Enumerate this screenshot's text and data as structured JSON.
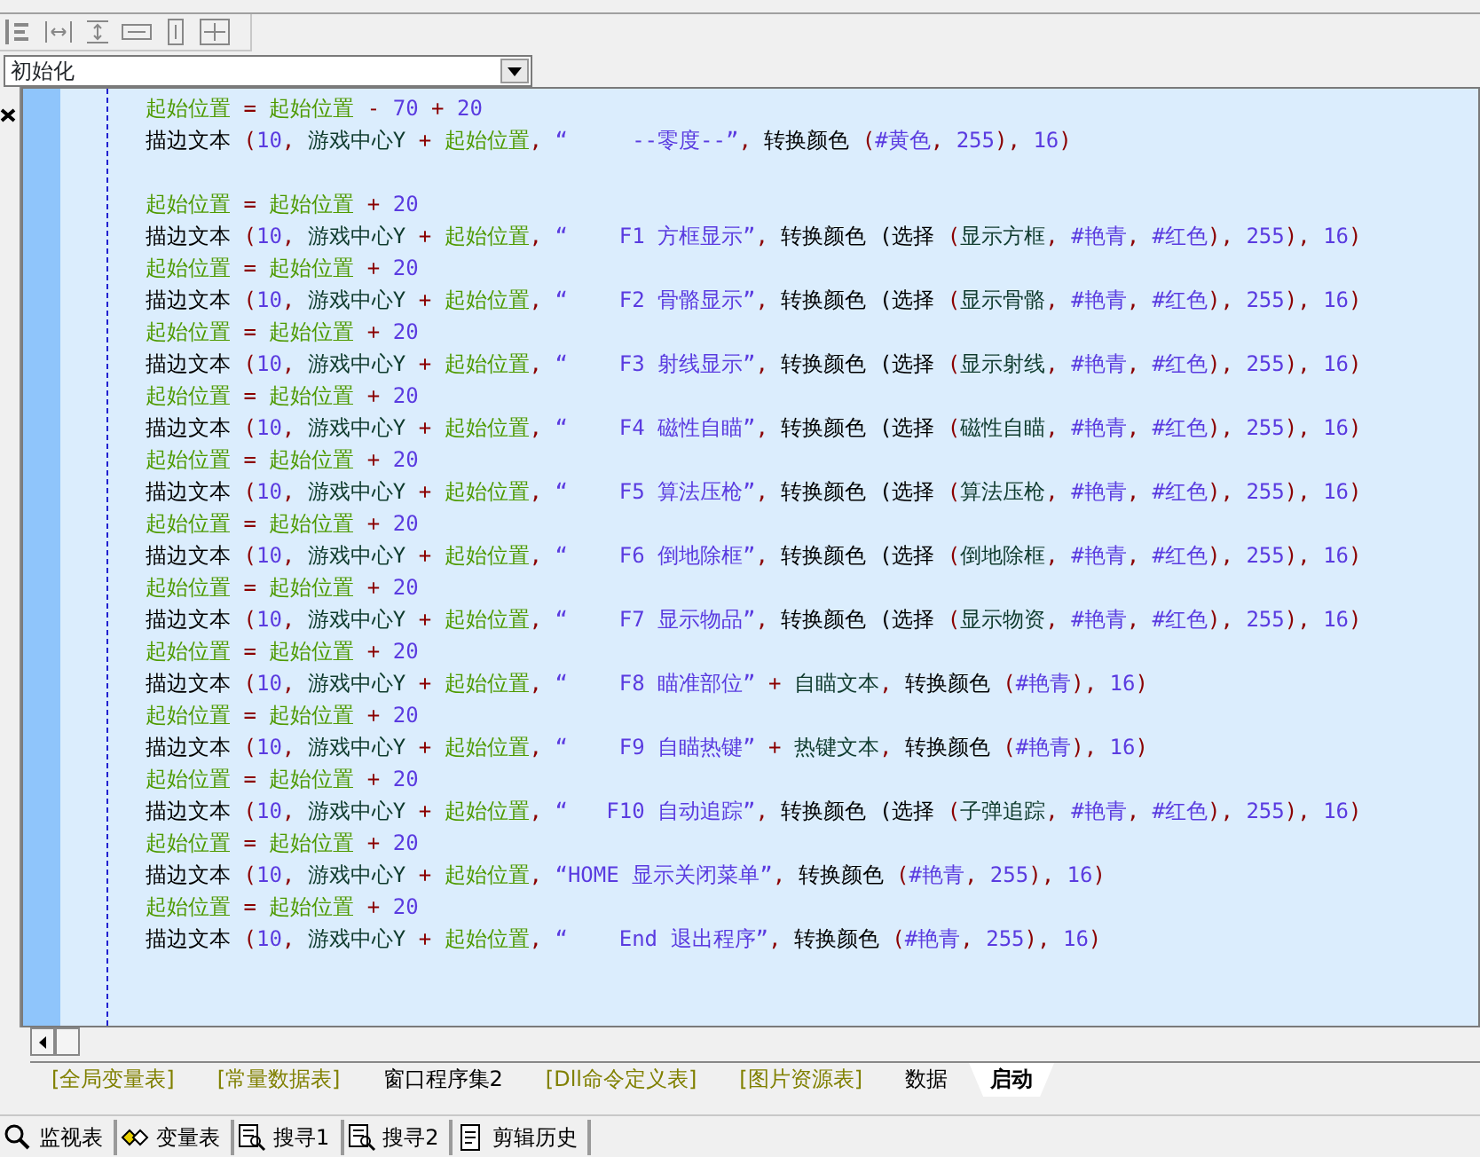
{
  "toolbar": {
    "buttons": [
      {
        "kind": "align-left"
      },
      {
        "kind": "space-h"
      },
      {
        "kind": "space-v"
      },
      {
        "kind": "size-h"
      },
      {
        "kind": "size-v"
      },
      {
        "kind": "size-both"
      }
    ]
  },
  "subroutine_select": {
    "value": "初始化"
  },
  "editor": {
    "lines": [
      {
        "kind": "code",
        "tokens": [
          {
            "kind": "var",
            "text": "起始位置"
          },
          {
            "kind": "op",
            "text": " = "
          },
          {
            "kind": "var",
            "text": "起始位置"
          },
          {
            "kind": "op",
            "text": " - "
          },
          {
            "kind": "num",
            "text": "70"
          },
          {
            "kind": "op",
            "text": " + "
          },
          {
            "kind": "num",
            "text": "20"
          }
        ]
      },
      {
        "kind": "code",
        "tokens": [
          {
            "kind": "func",
            "text": "描边文本 "
          },
          {
            "kind": "op",
            "text": "("
          },
          {
            "kind": "num",
            "text": "10"
          },
          {
            "kind": "op",
            "text": ", "
          },
          {
            "kind": "arg",
            "text": "游戏中心Y "
          },
          {
            "kind": "op",
            "text": "+ "
          },
          {
            "kind": "var",
            "text": "起始位置"
          },
          {
            "kind": "op",
            "text": ", "
          },
          {
            "kind": "str",
            "text": "“     --零度--”"
          },
          {
            "kind": "op",
            "text": ", "
          },
          {
            "kind": "func",
            "text": "转换颜色 "
          },
          {
            "kind": "op",
            "text": "("
          },
          {
            "kind": "str",
            "text": "#黄色"
          },
          {
            "kind": "op",
            "text": ", "
          },
          {
            "kind": "num",
            "text": "255"
          },
          {
            "kind": "op",
            "text": "), "
          },
          {
            "kind": "num",
            "text": "16"
          },
          {
            "kind": "op",
            "text": ")"
          }
        ]
      },
      {
        "kind": "blank"
      },
      {
        "kind": "code",
        "tokens": [
          {
            "kind": "var",
            "text": "起始位置"
          },
          {
            "kind": "op",
            "text": " = "
          },
          {
            "kind": "var",
            "text": "起始位置"
          },
          {
            "kind": "op",
            "text": " + "
          },
          {
            "kind": "num",
            "text": "20"
          }
        ]
      },
      {
        "kind": "code",
        "tokens": [
          {
            "kind": "func",
            "text": "描边文本 "
          },
          {
            "kind": "op",
            "text": "("
          },
          {
            "kind": "num",
            "text": "10"
          },
          {
            "kind": "op",
            "text": ", "
          },
          {
            "kind": "arg",
            "text": "游戏中心Y "
          },
          {
            "kind": "op",
            "text": "+ "
          },
          {
            "kind": "var",
            "text": "起始位置"
          },
          {
            "kind": "op",
            "text": ", "
          },
          {
            "kind": "str",
            "text": "“    F1 方框显示”"
          },
          {
            "kind": "op",
            "text": ", "
          },
          {
            "kind": "func",
            "text": "转换颜色 (选择 "
          },
          {
            "kind": "op",
            "text": "("
          },
          {
            "kind": "arg",
            "text": "显示方框"
          },
          {
            "kind": "op",
            "text": ", "
          },
          {
            "kind": "str",
            "text": "#艳青"
          },
          {
            "kind": "op",
            "text": ", "
          },
          {
            "kind": "str",
            "text": "#红色"
          },
          {
            "kind": "op",
            "text": "), "
          },
          {
            "kind": "num",
            "text": "255"
          },
          {
            "kind": "op",
            "text": "), "
          },
          {
            "kind": "num",
            "text": "16"
          },
          {
            "kind": "op",
            "text": ")"
          }
        ]
      },
      {
        "kind": "code",
        "tokens": [
          {
            "kind": "var",
            "text": "起始位置"
          },
          {
            "kind": "op",
            "text": " = "
          },
          {
            "kind": "var",
            "text": "起始位置"
          },
          {
            "kind": "op",
            "text": " + "
          },
          {
            "kind": "num",
            "text": "20"
          }
        ]
      },
      {
        "kind": "code",
        "tokens": [
          {
            "kind": "func",
            "text": "描边文本 "
          },
          {
            "kind": "op",
            "text": "("
          },
          {
            "kind": "num",
            "text": "10"
          },
          {
            "kind": "op",
            "text": ", "
          },
          {
            "kind": "arg",
            "text": "游戏中心Y "
          },
          {
            "kind": "op",
            "text": "+ "
          },
          {
            "kind": "var",
            "text": "起始位置"
          },
          {
            "kind": "op",
            "text": ", "
          },
          {
            "kind": "str",
            "text": "“    F2 骨骼显示”"
          },
          {
            "kind": "op",
            "text": ", "
          },
          {
            "kind": "func",
            "text": "转换颜色 (选择 "
          },
          {
            "kind": "op",
            "text": "("
          },
          {
            "kind": "arg",
            "text": "显示骨骼"
          },
          {
            "kind": "op",
            "text": ", "
          },
          {
            "kind": "str",
            "text": "#艳青"
          },
          {
            "kind": "op",
            "text": ", "
          },
          {
            "kind": "str",
            "text": "#红色"
          },
          {
            "kind": "op",
            "text": "), "
          },
          {
            "kind": "num",
            "text": "255"
          },
          {
            "kind": "op",
            "text": "), "
          },
          {
            "kind": "num",
            "text": "16"
          },
          {
            "kind": "op",
            "text": ")"
          }
        ]
      },
      {
        "kind": "code",
        "tokens": [
          {
            "kind": "var",
            "text": "起始位置"
          },
          {
            "kind": "op",
            "text": " = "
          },
          {
            "kind": "var",
            "text": "起始位置"
          },
          {
            "kind": "op",
            "text": " + "
          },
          {
            "kind": "num",
            "text": "20"
          }
        ]
      },
      {
        "kind": "code",
        "tokens": [
          {
            "kind": "func",
            "text": "描边文本 "
          },
          {
            "kind": "op",
            "text": "("
          },
          {
            "kind": "num",
            "text": "10"
          },
          {
            "kind": "op",
            "text": ", "
          },
          {
            "kind": "arg",
            "text": "游戏中心Y "
          },
          {
            "kind": "op",
            "text": "+ "
          },
          {
            "kind": "var",
            "text": "起始位置"
          },
          {
            "kind": "op",
            "text": ", "
          },
          {
            "kind": "str",
            "text": "“    F3 射线显示”"
          },
          {
            "kind": "op",
            "text": ", "
          },
          {
            "kind": "func",
            "text": "转换颜色 (选择 "
          },
          {
            "kind": "op",
            "text": "("
          },
          {
            "kind": "arg",
            "text": "显示射线"
          },
          {
            "kind": "op",
            "text": ", "
          },
          {
            "kind": "str",
            "text": "#艳青"
          },
          {
            "kind": "op",
            "text": ", "
          },
          {
            "kind": "str",
            "text": "#红色"
          },
          {
            "kind": "op",
            "text": "), "
          },
          {
            "kind": "num",
            "text": "255"
          },
          {
            "kind": "op",
            "text": "), "
          },
          {
            "kind": "num",
            "text": "16"
          },
          {
            "kind": "op",
            "text": ")"
          }
        ]
      },
      {
        "kind": "code",
        "tokens": [
          {
            "kind": "var",
            "text": "起始位置"
          },
          {
            "kind": "op",
            "text": " = "
          },
          {
            "kind": "var",
            "text": "起始位置"
          },
          {
            "kind": "op",
            "text": " + "
          },
          {
            "kind": "num",
            "text": "20"
          }
        ]
      },
      {
        "kind": "code",
        "tokens": [
          {
            "kind": "func",
            "text": "描边文本 "
          },
          {
            "kind": "op",
            "text": "("
          },
          {
            "kind": "num",
            "text": "10"
          },
          {
            "kind": "op",
            "text": ", "
          },
          {
            "kind": "arg",
            "text": "游戏中心Y "
          },
          {
            "kind": "op",
            "text": "+ "
          },
          {
            "kind": "var",
            "text": "起始位置"
          },
          {
            "kind": "op",
            "text": ", "
          },
          {
            "kind": "str",
            "text": "“    F4 磁性自瞄”"
          },
          {
            "kind": "op",
            "text": ", "
          },
          {
            "kind": "func",
            "text": "转换颜色 (选择 "
          },
          {
            "kind": "op",
            "text": "("
          },
          {
            "kind": "arg",
            "text": "磁性自瞄"
          },
          {
            "kind": "op",
            "text": ", "
          },
          {
            "kind": "str",
            "text": "#艳青"
          },
          {
            "kind": "op",
            "text": ", "
          },
          {
            "kind": "str",
            "text": "#红色"
          },
          {
            "kind": "op",
            "text": "), "
          },
          {
            "kind": "num",
            "text": "255"
          },
          {
            "kind": "op",
            "text": "), "
          },
          {
            "kind": "num",
            "text": "16"
          },
          {
            "kind": "op",
            "text": ")"
          }
        ]
      },
      {
        "kind": "code",
        "tokens": [
          {
            "kind": "var",
            "text": "起始位置"
          },
          {
            "kind": "op",
            "text": " = "
          },
          {
            "kind": "var",
            "text": "起始位置"
          },
          {
            "kind": "op",
            "text": " + "
          },
          {
            "kind": "num",
            "text": "20"
          }
        ]
      },
      {
        "kind": "code",
        "tokens": [
          {
            "kind": "func",
            "text": "描边文本 "
          },
          {
            "kind": "op",
            "text": "("
          },
          {
            "kind": "num",
            "text": "10"
          },
          {
            "kind": "op",
            "text": ", "
          },
          {
            "kind": "arg",
            "text": "游戏中心Y "
          },
          {
            "kind": "op",
            "text": "+ "
          },
          {
            "kind": "var",
            "text": "起始位置"
          },
          {
            "kind": "op",
            "text": ", "
          },
          {
            "kind": "str",
            "text": "“    F5 算法压枪”"
          },
          {
            "kind": "op",
            "text": ", "
          },
          {
            "kind": "func",
            "text": "转换颜色 (选择 "
          },
          {
            "kind": "op",
            "text": "("
          },
          {
            "kind": "arg",
            "text": "算法压枪"
          },
          {
            "kind": "op",
            "text": ", "
          },
          {
            "kind": "str",
            "text": "#艳青"
          },
          {
            "kind": "op",
            "text": ", "
          },
          {
            "kind": "str",
            "text": "#红色"
          },
          {
            "kind": "op",
            "text": "), "
          },
          {
            "kind": "num",
            "text": "255"
          },
          {
            "kind": "op",
            "text": "), "
          },
          {
            "kind": "num",
            "text": "16"
          },
          {
            "kind": "op",
            "text": ")"
          }
        ]
      },
      {
        "kind": "code",
        "tokens": [
          {
            "kind": "var",
            "text": "起始位置"
          },
          {
            "kind": "op",
            "text": " = "
          },
          {
            "kind": "var",
            "text": "起始位置"
          },
          {
            "kind": "op",
            "text": " + "
          },
          {
            "kind": "num",
            "text": "20"
          }
        ]
      },
      {
        "kind": "code",
        "tokens": [
          {
            "kind": "func",
            "text": "描边文本 "
          },
          {
            "kind": "op",
            "text": "("
          },
          {
            "kind": "num",
            "text": "10"
          },
          {
            "kind": "op",
            "text": ", "
          },
          {
            "kind": "arg",
            "text": "游戏中心Y "
          },
          {
            "kind": "op",
            "text": "+ "
          },
          {
            "kind": "var",
            "text": "起始位置"
          },
          {
            "kind": "op",
            "text": ", "
          },
          {
            "kind": "str",
            "text": "“    F6 倒地除框”"
          },
          {
            "kind": "op",
            "text": ", "
          },
          {
            "kind": "func",
            "text": "转换颜色 (选择 "
          },
          {
            "kind": "op",
            "text": "("
          },
          {
            "kind": "arg",
            "text": "倒地除框"
          },
          {
            "kind": "op",
            "text": ", "
          },
          {
            "kind": "str",
            "text": "#艳青"
          },
          {
            "kind": "op",
            "text": ", "
          },
          {
            "kind": "str",
            "text": "#红色"
          },
          {
            "kind": "op",
            "text": "), "
          },
          {
            "kind": "num",
            "text": "255"
          },
          {
            "kind": "op",
            "text": "), "
          },
          {
            "kind": "num",
            "text": "16"
          },
          {
            "kind": "op",
            "text": ")"
          }
        ]
      },
      {
        "kind": "code",
        "tokens": [
          {
            "kind": "var",
            "text": "起始位置"
          },
          {
            "kind": "op",
            "text": " = "
          },
          {
            "kind": "var",
            "text": "起始位置"
          },
          {
            "kind": "op",
            "text": " + "
          },
          {
            "kind": "num",
            "text": "20"
          }
        ]
      },
      {
        "kind": "code",
        "tokens": [
          {
            "kind": "func",
            "text": "描边文本 "
          },
          {
            "kind": "op",
            "text": "("
          },
          {
            "kind": "num",
            "text": "10"
          },
          {
            "kind": "op",
            "text": ", "
          },
          {
            "kind": "arg",
            "text": "游戏中心Y "
          },
          {
            "kind": "op",
            "text": "+ "
          },
          {
            "kind": "var",
            "text": "起始位置"
          },
          {
            "kind": "op",
            "text": ", "
          },
          {
            "kind": "str",
            "text": "“    F7 显示物品”"
          },
          {
            "kind": "op",
            "text": ", "
          },
          {
            "kind": "func",
            "text": "转换颜色 (选择 "
          },
          {
            "kind": "op",
            "text": "("
          },
          {
            "kind": "arg",
            "text": "显示物资"
          },
          {
            "kind": "op",
            "text": ", "
          },
          {
            "kind": "str",
            "text": "#艳青"
          },
          {
            "kind": "op",
            "text": ", "
          },
          {
            "kind": "str",
            "text": "#红色"
          },
          {
            "kind": "op",
            "text": "), "
          },
          {
            "kind": "num",
            "text": "255"
          },
          {
            "kind": "op",
            "text": "), "
          },
          {
            "kind": "num",
            "text": "16"
          },
          {
            "kind": "op",
            "text": ")"
          }
        ]
      },
      {
        "kind": "code",
        "tokens": [
          {
            "kind": "var",
            "text": "起始位置"
          },
          {
            "kind": "op",
            "text": " = "
          },
          {
            "kind": "var",
            "text": "起始位置"
          },
          {
            "kind": "op",
            "text": " + "
          },
          {
            "kind": "num",
            "text": "20"
          }
        ]
      },
      {
        "kind": "code",
        "tokens": [
          {
            "kind": "func",
            "text": "描边文本 "
          },
          {
            "kind": "op",
            "text": "("
          },
          {
            "kind": "num",
            "text": "10"
          },
          {
            "kind": "op",
            "text": ", "
          },
          {
            "kind": "arg",
            "text": "游戏中心Y "
          },
          {
            "kind": "op",
            "text": "+ "
          },
          {
            "kind": "var",
            "text": "起始位置"
          },
          {
            "kind": "op",
            "text": ", "
          },
          {
            "kind": "str",
            "text": "“    F8 瞄准部位”"
          },
          {
            "kind": "op",
            "text": " + "
          },
          {
            "kind": "arg",
            "text": "自瞄文本"
          },
          {
            "kind": "op",
            "text": ", "
          },
          {
            "kind": "func",
            "text": "转换颜色 "
          },
          {
            "kind": "op",
            "text": "("
          },
          {
            "kind": "str",
            "text": "#艳青"
          },
          {
            "kind": "op",
            "text": "), "
          },
          {
            "kind": "num",
            "text": "16"
          },
          {
            "kind": "op",
            "text": ")"
          }
        ]
      },
      {
        "kind": "code",
        "tokens": [
          {
            "kind": "var",
            "text": "起始位置"
          },
          {
            "kind": "op",
            "text": " = "
          },
          {
            "kind": "var",
            "text": "起始位置"
          },
          {
            "kind": "op",
            "text": " + "
          },
          {
            "kind": "num",
            "text": "20"
          }
        ]
      },
      {
        "kind": "code",
        "tokens": [
          {
            "kind": "func",
            "text": "描边文本 "
          },
          {
            "kind": "op",
            "text": "("
          },
          {
            "kind": "num",
            "text": "10"
          },
          {
            "kind": "op",
            "text": ", "
          },
          {
            "kind": "arg",
            "text": "游戏中心Y "
          },
          {
            "kind": "op",
            "text": "+ "
          },
          {
            "kind": "var",
            "text": "起始位置"
          },
          {
            "kind": "op",
            "text": ", "
          },
          {
            "kind": "str",
            "text": "“    F9 自瞄热键”"
          },
          {
            "kind": "op",
            "text": " + "
          },
          {
            "kind": "arg",
            "text": "热键文本"
          },
          {
            "kind": "op",
            "text": ", "
          },
          {
            "kind": "func",
            "text": "转换颜色 "
          },
          {
            "kind": "op",
            "text": "("
          },
          {
            "kind": "str",
            "text": "#艳青"
          },
          {
            "kind": "op",
            "text": "), "
          },
          {
            "kind": "num",
            "text": "16"
          },
          {
            "kind": "op",
            "text": ")"
          }
        ]
      },
      {
        "kind": "code",
        "tokens": [
          {
            "kind": "var",
            "text": "起始位置"
          },
          {
            "kind": "op",
            "text": " = "
          },
          {
            "kind": "var",
            "text": "起始位置"
          },
          {
            "kind": "op",
            "text": " + "
          },
          {
            "kind": "num",
            "text": "20"
          }
        ]
      },
      {
        "kind": "code",
        "tokens": [
          {
            "kind": "func",
            "text": "描边文本 "
          },
          {
            "kind": "op",
            "text": "("
          },
          {
            "kind": "num",
            "text": "10"
          },
          {
            "kind": "op",
            "text": ", "
          },
          {
            "kind": "arg",
            "text": "游戏中心Y "
          },
          {
            "kind": "op",
            "text": "+ "
          },
          {
            "kind": "var",
            "text": "起始位置"
          },
          {
            "kind": "op",
            "text": ", "
          },
          {
            "kind": "str",
            "text": "“   F10 自动追踪”"
          },
          {
            "kind": "op",
            "text": ", "
          },
          {
            "kind": "func",
            "text": "转换颜色 (选择 "
          },
          {
            "kind": "op",
            "text": "("
          },
          {
            "kind": "arg",
            "text": "子弹追踪"
          },
          {
            "kind": "op",
            "text": ", "
          },
          {
            "kind": "str",
            "text": "#艳青"
          },
          {
            "kind": "op",
            "text": ", "
          },
          {
            "kind": "str",
            "text": "#红色"
          },
          {
            "kind": "op",
            "text": "), "
          },
          {
            "kind": "num",
            "text": "255"
          },
          {
            "kind": "op",
            "text": "), "
          },
          {
            "kind": "num",
            "text": "16"
          },
          {
            "kind": "op",
            "text": ")"
          }
        ]
      },
      {
        "kind": "code",
        "tokens": [
          {
            "kind": "var",
            "text": "起始位置"
          },
          {
            "kind": "op",
            "text": " = "
          },
          {
            "kind": "var",
            "text": "起始位置"
          },
          {
            "kind": "op",
            "text": " + "
          },
          {
            "kind": "num",
            "text": "20"
          }
        ]
      },
      {
        "kind": "code",
        "tokens": [
          {
            "kind": "func",
            "text": "描边文本 "
          },
          {
            "kind": "op",
            "text": "("
          },
          {
            "kind": "num",
            "text": "10"
          },
          {
            "kind": "op",
            "text": ", "
          },
          {
            "kind": "arg",
            "text": "游戏中心Y "
          },
          {
            "kind": "op",
            "text": "+ "
          },
          {
            "kind": "var",
            "text": "起始位置"
          },
          {
            "kind": "op",
            "text": ", "
          },
          {
            "kind": "str",
            "text": "“HOME 显示关闭菜单”"
          },
          {
            "kind": "op",
            "text": ", "
          },
          {
            "kind": "func",
            "text": "转换颜色 "
          },
          {
            "kind": "op",
            "text": "("
          },
          {
            "kind": "str",
            "text": "#艳青"
          },
          {
            "kind": "op",
            "text": ", "
          },
          {
            "kind": "num",
            "text": "255"
          },
          {
            "kind": "op",
            "text": "), "
          },
          {
            "kind": "num",
            "text": "16"
          },
          {
            "kind": "op",
            "text": ")"
          }
        ]
      },
      {
        "kind": "code",
        "tokens": [
          {
            "kind": "var",
            "text": "起始位置"
          },
          {
            "kind": "op",
            "text": " = "
          },
          {
            "kind": "var",
            "text": "起始位置"
          },
          {
            "kind": "op",
            "text": " + "
          },
          {
            "kind": "num",
            "text": "20"
          }
        ]
      },
      {
        "kind": "code",
        "tokens": [
          {
            "kind": "func",
            "text": "描边文本 "
          },
          {
            "kind": "op",
            "text": "("
          },
          {
            "kind": "num",
            "text": "10"
          },
          {
            "kind": "op",
            "text": ", "
          },
          {
            "kind": "arg",
            "text": "游戏中心Y "
          },
          {
            "kind": "op",
            "text": "+ "
          },
          {
            "kind": "var",
            "text": "起始位置"
          },
          {
            "kind": "op",
            "text": ", "
          },
          {
            "kind": "str",
            "text": "“    End 退出程序”"
          },
          {
            "kind": "op",
            "text": ", "
          },
          {
            "kind": "func",
            "text": "转换颜色 "
          },
          {
            "kind": "op",
            "text": "("
          },
          {
            "kind": "str",
            "text": "#艳青"
          },
          {
            "kind": "op",
            "text": ", "
          },
          {
            "kind": "num",
            "text": "255"
          },
          {
            "kind": "op",
            "text": "), "
          },
          {
            "kind": "num",
            "text": "16"
          },
          {
            "kind": "op",
            "text": ")"
          }
        ]
      }
    ]
  },
  "tabs": [
    {
      "label": "[全局变量表]",
      "color": "#808000",
      "selected": false
    },
    {
      "label": "[常量数据表]",
      "color": "#808000",
      "selected": false
    },
    {
      "label": "窗口程序集2",
      "color": "#000000",
      "selected": false
    },
    {
      "label": "[Dll命令定义表]",
      "color": "#808000",
      "selected": false
    },
    {
      "label": "[图片资源表]",
      "color": "#808000",
      "selected": false
    },
    {
      "label": "数据",
      "color": "#000000",
      "selected": false
    },
    {
      "label": "启动",
      "color": "#000000",
      "selected": true
    }
  ],
  "bottom_panel": {
    "buttons": [
      {
        "kind": "search",
        "label": "监视表"
      },
      {
        "kind": "vars",
        "label": "变量表"
      },
      {
        "kind": "find",
        "label": "搜寻1"
      },
      {
        "kind": "find",
        "label": "搜寻2"
      },
      {
        "kind": "clip",
        "label": "剪辑历史"
      }
    ]
  }
}
